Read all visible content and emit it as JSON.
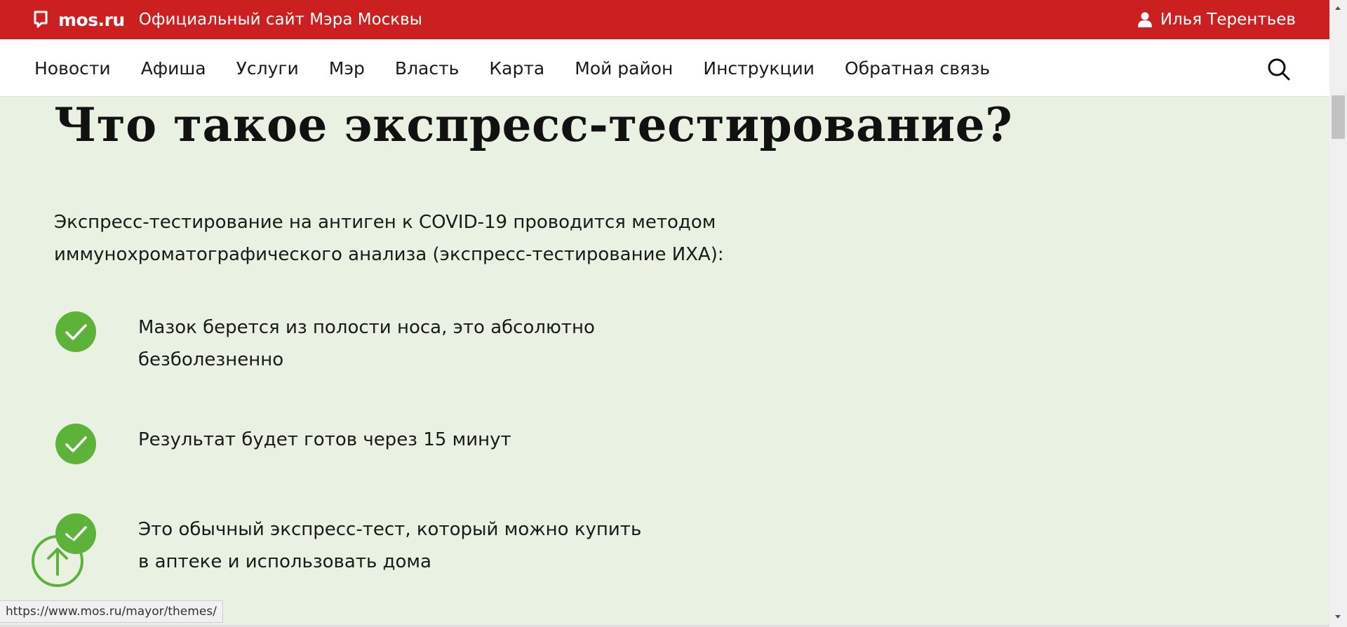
{
  "header": {
    "logo_icon": "speech-bubble-icon",
    "logo_text": "mos.ru",
    "site_title": "Официальный сайт Мэра Москвы",
    "user_icon": "user-icon",
    "user_name": "Илья Терентьев",
    "color": "#cc2020"
  },
  "nav": {
    "items": [
      {
        "label": "Новости"
      },
      {
        "label": "Афиша"
      },
      {
        "label": "Услуги"
      },
      {
        "label": "Мэр"
      },
      {
        "label": "Власть"
      },
      {
        "label": "Карта"
      },
      {
        "label": "Мой район"
      },
      {
        "label": "Инструкции"
      },
      {
        "label": "Обратная связь"
      }
    ],
    "search_icon": "search-icon"
  },
  "main": {
    "heading": "Что такое экспресс-тестирование?",
    "intro_lines": [
      "Экспресс-тестирование на антиген к COVID-19 проводится методом",
      "иммунохроматографического анализа (экспресс-тестирование ИХА):"
    ],
    "bullets": [
      {
        "lines": [
          "Мазок берется из полости носа, это абсолютно",
          "безболезненно"
        ]
      },
      {
        "lines": [
          "Результат будет готов через 15 минут"
        ]
      },
      {
        "lines": [
          "Это обычный экспресс-тест, который можно купить",
          "в аптеке и использовать дома"
        ]
      }
    ],
    "bullet_icon": "check-icon",
    "accent_color": "#5db33a",
    "background_color": "#e9f1e2"
  },
  "scroll_top_icon": "arrow-up-icon",
  "status_url": "https://www.mos.ru/mayor/themes/"
}
